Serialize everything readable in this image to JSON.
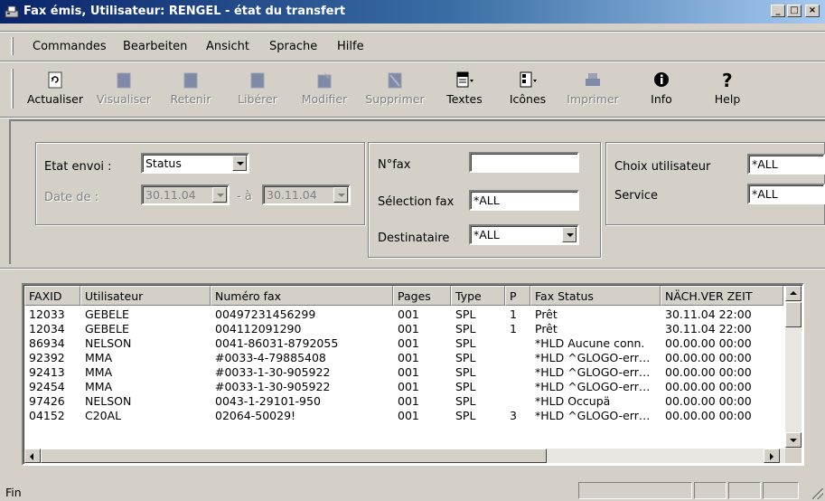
{
  "window": {
    "title": "Fax émis, Utilisateur: RENGEL - état du transfert",
    "controls": {
      "minimize": "_",
      "maximize": "□",
      "close": "×"
    }
  },
  "menu": [
    "Commandes",
    "Bearbeiten",
    "Ansicht",
    "Sprache",
    "Hilfe"
  ],
  "toolbar": [
    {
      "label": "Actualiser",
      "icon": "refresh-icon",
      "enabled": true
    },
    {
      "label": "Visualiser",
      "icon": "view-icon",
      "enabled": false
    },
    {
      "label": "Retenir",
      "icon": "hold-icon",
      "enabled": false
    },
    {
      "label": "Libérer",
      "icon": "release-icon",
      "enabled": false
    },
    {
      "label": "Modifier",
      "icon": "edit-icon",
      "enabled": false
    },
    {
      "label": "Supprimer",
      "icon": "delete-icon",
      "enabled": false
    },
    {
      "label": "Textes",
      "icon": "text-doc-icon",
      "enabled": true
    },
    {
      "label": "Icônes",
      "icon": "icons-doc-icon",
      "enabled": true
    },
    {
      "label": "Imprimer",
      "icon": "print-icon",
      "enabled": false
    },
    {
      "label": "Info",
      "icon": "info-icon",
      "enabled": true
    },
    {
      "label": "Help",
      "icon": "help-icon",
      "enabled": true
    }
  ],
  "filters": {
    "etat_envoi_label": "Etat envoi :",
    "etat_envoi_value": "Status",
    "date_de_label": "Date de :",
    "date_from": "30.11.04",
    "date_sep": "- à",
    "date_to": "30.11.04",
    "nfax_label": "N°fax",
    "nfax_value": "",
    "selection_fax_label": "Sélection fax",
    "selection_fax_value": "*ALL",
    "destinataire_label": "Destinataire",
    "destinataire_value": "*ALL",
    "choix_utilisateur_label": "Choix utilisateur",
    "choix_utilisateur_value": "*ALL",
    "service_label": "Service",
    "service_value": "*ALL"
  },
  "list": {
    "columns": [
      "FAXID",
      "Utilisateur",
      "Numéro fax",
      "Pages",
      "Type",
      "P",
      "Fax Status",
      "NÄCH.VER ZEIT"
    ],
    "rows": [
      [
        "12033",
        "GEBELE",
        "00497231456299",
        "001",
        "SPL",
        "1",
        "Prêt",
        "30.11.04 22:00"
      ],
      [
        "12034",
        "GEBELE",
        "004112091290",
        "001",
        "SPL",
        "1",
        "Prêt",
        "30.11.04 22:00"
      ],
      [
        "86934",
        "NELSON",
        "0041-86031-8792055",
        "001",
        "SPL",
        "",
        "*HLD Aucune conn.",
        "00.00.00 00:00"
      ],
      [
        "92392",
        "MMA",
        "#0033-4-79885408",
        "001",
        "SPL",
        "",
        "*HLD ^GLOGO-err…",
        "00.00.00 00:00"
      ],
      [
        "92413",
        "MMA",
        "#0033-1-30-905922",
        "001",
        "SPL",
        "",
        "*HLD ^GLOGO-err…",
        "00.00.00 00:00"
      ],
      [
        "92454",
        "MMA",
        "#0033-1-30-905922",
        "001",
        "SPL",
        "",
        "*HLD ^GLOGO-err…",
        "00.00.00 00:00"
      ],
      [
        "97426",
        "NELSON",
        "0043-1-29101-950",
        "001",
        "SPL",
        "",
        "*HLD Occupä",
        "00.00.00 00:00"
      ],
      [
        "04152",
        "C20AL",
        "02064-50029!",
        "001",
        "SPL",
        "3",
        "*HLD ^GLOGO-err…",
        "00.00.00 00:00"
      ]
    ]
  },
  "status_bar": {
    "text": "Fin"
  }
}
